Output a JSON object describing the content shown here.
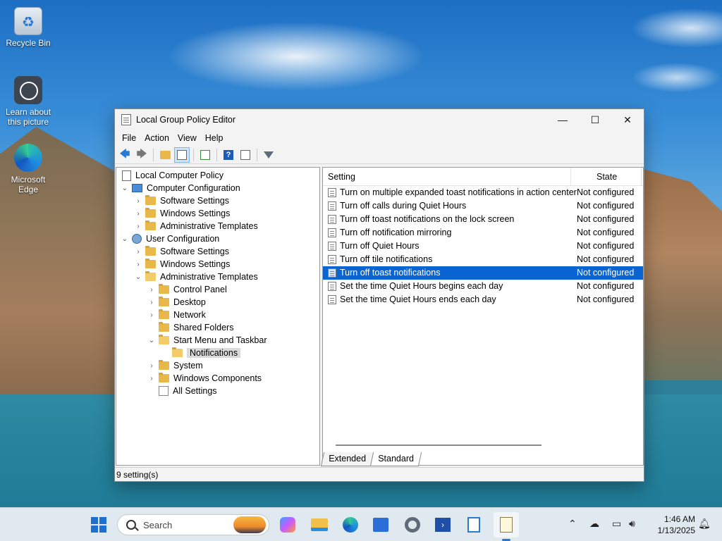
{
  "desktop": {
    "icons": [
      {
        "label": "Recycle Bin",
        "icon": "recycle-bin-icon"
      },
      {
        "label": "Learn about this picture",
        "icon": "learn-picture-icon"
      },
      {
        "label": "Microsoft Edge",
        "icon": "edge-icon"
      }
    ]
  },
  "window": {
    "title": "Local Group Policy Editor",
    "controls": {
      "minimize": "—",
      "maximize": "☐",
      "close": "✕"
    },
    "menu": [
      "File",
      "Action",
      "View",
      "Help"
    ],
    "toolbar": [
      "back-icon",
      "forward-icon",
      "up-folder-icon",
      "show-hide-tree-icon",
      "export-list-icon",
      "help-icon",
      "properties-icon",
      "filter-icon"
    ]
  },
  "tree": {
    "items": [
      {
        "label": "Local Computer Policy",
        "level": 0,
        "icon": "policy-icon",
        "expand": ""
      },
      {
        "label": "Computer Configuration",
        "level": 1,
        "icon": "computer-icon",
        "expand": "open"
      },
      {
        "label": "Software Settings",
        "level": 2,
        "icon": "folder-icon",
        "expand": "closed"
      },
      {
        "label": "Windows Settings",
        "level": 2,
        "icon": "folder-icon",
        "expand": "closed"
      },
      {
        "label": "Administrative Templates",
        "level": 2,
        "icon": "folder-icon",
        "expand": "closed"
      },
      {
        "label": "User Configuration",
        "level": 1,
        "icon": "user-icon",
        "expand": "open"
      },
      {
        "label": "Software Settings",
        "level": 2,
        "icon": "folder-icon",
        "expand": "closed"
      },
      {
        "label": "Windows Settings",
        "level": 2,
        "icon": "folder-icon",
        "expand": "closed"
      },
      {
        "label": "Administrative Templates",
        "level": 2,
        "icon": "folder-icon",
        "expand": "open"
      },
      {
        "label": "Control Panel",
        "level": 3,
        "icon": "folder-icon",
        "expand": "closed"
      },
      {
        "label": "Desktop",
        "level": 3,
        "icon": "folder-icon",
        "expand": "closed"
      },
      {
        "label": "Network",
        "level": 3,
        "icon": "folder-icon",
        "expand": "closed"
      },
      {
        "label": "Shared Folders",
        "level": 3,
        "icon": "folder-icon",
        "expand": ""
      },
      {
        "label": "Start Menu and Taskbar",
        "level": 3,
        "icon": "folder-icon",
        "expand": "open"
      },
      {
        "label": "Notifications",
        "level": 4,
        "icon": "folder-open-icon",
        "expand": "",
        "selected": true
      },
      {
        "label": "System",
        "level": 3,
        "icon": "folder-icon",
        "expand": "closed"
      },
      {
        "label": "Windows Components",
        "level": 3,
        "icon": "folder-icon",
        "expand": "closed"
      },
      {
        "label": "All Settings",
        "level": 3,
        "icon": "all-settings-icon",
        "expand": ""
      }
    ]
  },
  "list": {
    "columns": {
      "setting": "Setting",
      "state": "State"
    },
    "rows": [
      {
        "setting": "Turn on multiple expanded toast notifications in action center",
        "state": "Not configured"
      },
      {
        "setting": "Turn off calls during Quiet Hours",
        "state": "Not configured"
      },
      {
        "setting": "Turn off toast notifications on the lock screen",
        "state": "Not configured"
      },
      {
        "setting": "Turn off notification mirroring",
        "state": "Not configured"
      },
      {
        "setting": "Turn off Quiet Hours",
        "state": "Not configured"
      },
      {
        "setting": "Turn off tile notifications",
        "state": "Not configured"
      },
      {
        "setting": "Turn off toast notifications",
        "state": "Not configured",
        "selected": true
      },
      {
        "setting": "Set the time Quiet Hours begins each day",
        "state": "Not configured"
      },
      {
        "setting": "Set the time Quiet Hours ends each day",
        "state": "Not configured"
      }
    ],
    "tabs": [
      "Extended",
      "Standard"
    ],
    "active_tab": "Standard"
  },
  "status": {
    "text": "9 setting(s)"
  },
  "taskbar": {
    "search_placeholder": "Search",
    "apps": [
      "start-icon",
      "copilot-icon",
      "file-explorer-icon",
      "edge-icon",
      "store-icon",
      "settings-icon",
      "terminal-icon",
      "notepad-icon",
      "group-policy-icon"
    ],
    "clock": {
      "time": "1:46 AM",
      "date": "1/13/2025"
    }
  }
}
